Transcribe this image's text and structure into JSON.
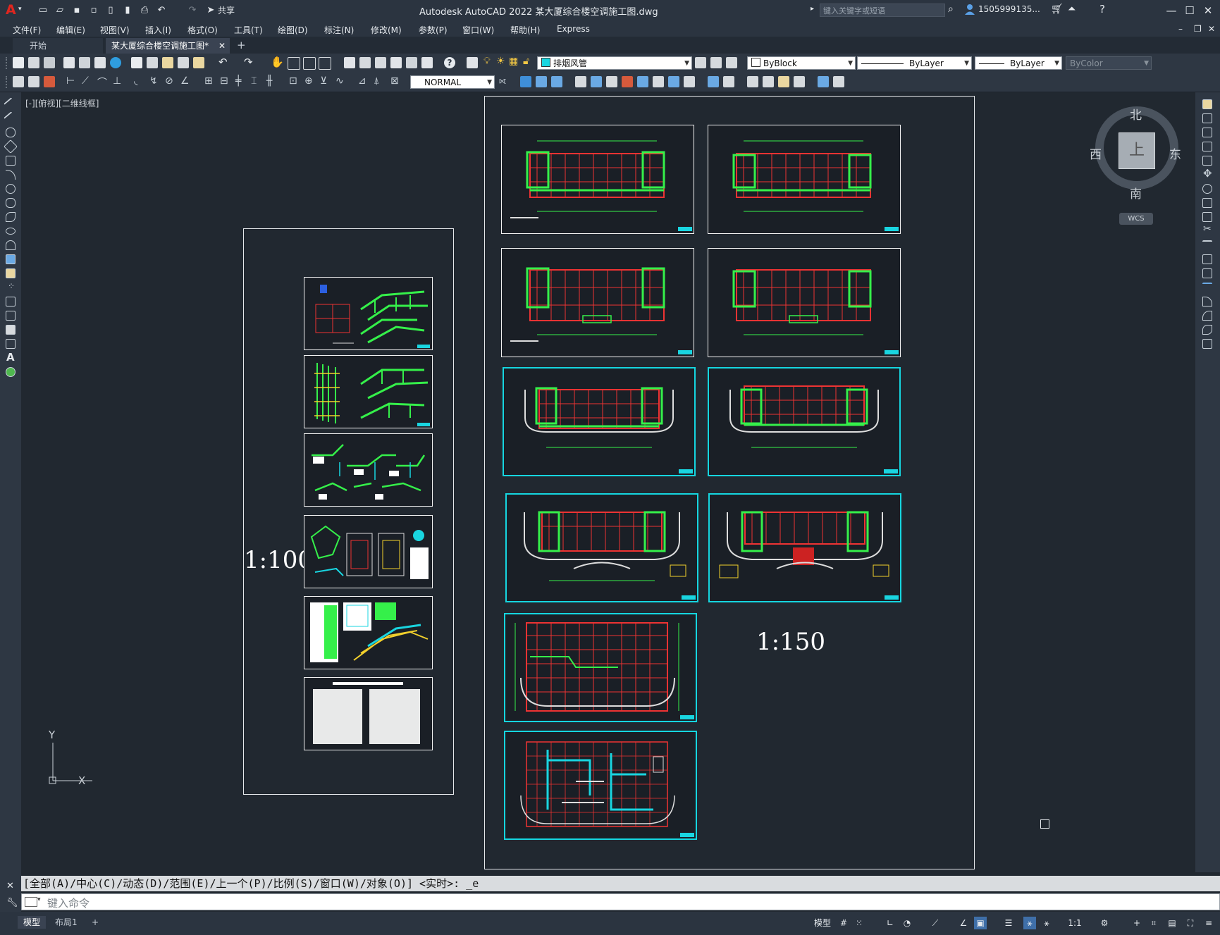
{
  "app": {
    "title": "Autodesk AutoCAD 2022    某大厦综合楼空调施工图.dwg",
    "logo": "A",
    "share_label": "共享",
    "search_placeholder": "键入关键字或短语",
    "user": "1505999135...",
    "accent": "#e0261f"
  },
  "menu": [
    "文件(F)",
    "编辑(E)",
    "视图(V)",
    "插入(I)",
    "格式(O)",
    "工具(T)",
    "绘图(D)",
    "标注(N)",
    "修改(M)",
    "参数(P)",
    "窗口(W)",
    "帮助(H)",
    "Express"
  ],
  "tabs": {
    "start": "开始",
    "drawing": "某大厦综合楼空调施工图*",
    "add": "+"
  },
  "toolbar": {
    "layer": "排烟风管",
    "color": "ByBlock",
    "linetype": "ByLayer",
    "lineweight": "ByLayer",
    "plotstyle": "ByColor",
    "textstyle": "NORMAL"
  },
  "viewport": {
    "label": "[-][俯视][二维线框]",
    "ucs_x": "X",
    "ucs_y": "Y"
  },
  "viewcube": {
    "north": "北",
    "south": "南",
    "west": "西",
    "east": "东",
    "top": "上",
    "wcs": "WCS"
  },
  "drawing": {
    "scale_left": "1:100",
    "scale_right": "1:150"
  },
  "command": {
    "history": "[全部(A)/中心(C)/动态(D)/范围(E)/上一个(P)/比例(S)/窗口(W)/对象(O)] <实时>: _e",
    "placeholder": "键入命令"
  },
  "layout_tabs": [
    "模型",
    "布局1",
    "+"
  ],
  "status": {
    "model": "模型",
    "scale": "1:1"
  }
}
